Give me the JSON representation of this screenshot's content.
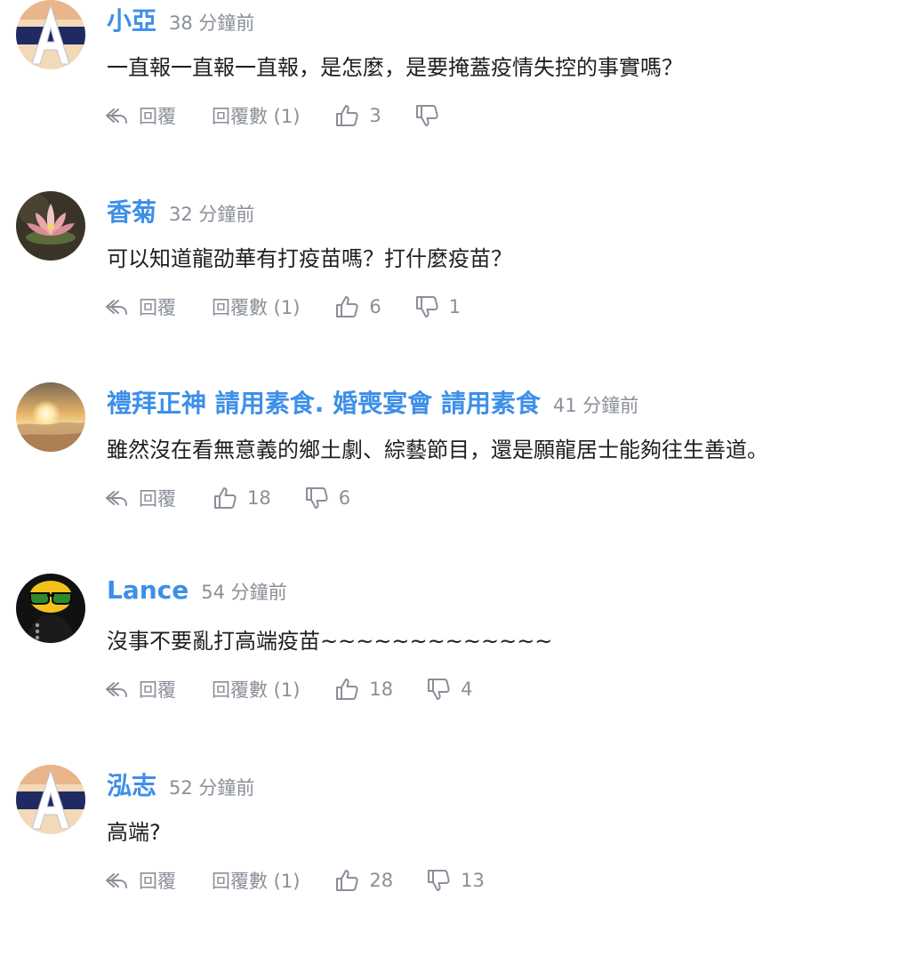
{
  "comments": [
    {
      "author": "小亞",
      "time": "38 分鐘前",
      "text": "一直報一直報一直報，是怎麼，是要掩蓋疫情失控的事實嗎？",
      "reply_label": "回覆",
      "replies_label": "回覆數 (1)",
      "likes": "3",
      "dislikes": "",
      "avatar": "letter-a-avatar"
    },
    {
      "author": "香菊",
      "time": "32 分鐘前",
      "text": "可以知道龍劭華有打疫苗嗎？打什麼疫苗？",
      "reply_label": "回覆",
      "replies_label": "回覆數 (1)",
      "likes": "6",
      "dislikes": "1",
      "avatar": "lotus-avatar"
    },
    {
      "author": "禮拜正神 請用素食. 婚喪宴會 請用素食",
      "time": "41 分鐘前",
      "text": "雖然沒在看無意義的鄉土劇、綜藝節目，還是願龍居士能夠往生善道。",
      "reply_label": "回覆",
      "replies_label": "",
      "likes": "18",
      "dislikes": "6",
      "avatar": "sunset-avatar"
    },
    {
      "author": "Lance",
      "time": "54 分鐘前",
      "text": "沒事不要亂打高端疫苗~~~~~~~~~~~~~",
      "reply_label": "回覆",
      "replies_label": "回覆數 (1)",
      "likes": "18",
      "dislikes": "4",
      "avatar": "sunglasses-avatar"
    },
    {
      "author": "泓志",
      "time": "52 分鐘前",
      "text": "高端?",
      "reply_label": "回覆",
      "replies_label": "回覆數 (1)",
      "likes": "28",
      "dislikes": "13",
      "avatar": "letter-a-avatar"
    }
  ],
  "colors": {
    "author": "#3d8fe8",
    "meta": "#8a8f98",
    "text": "#1f1f1f"
  }
}
